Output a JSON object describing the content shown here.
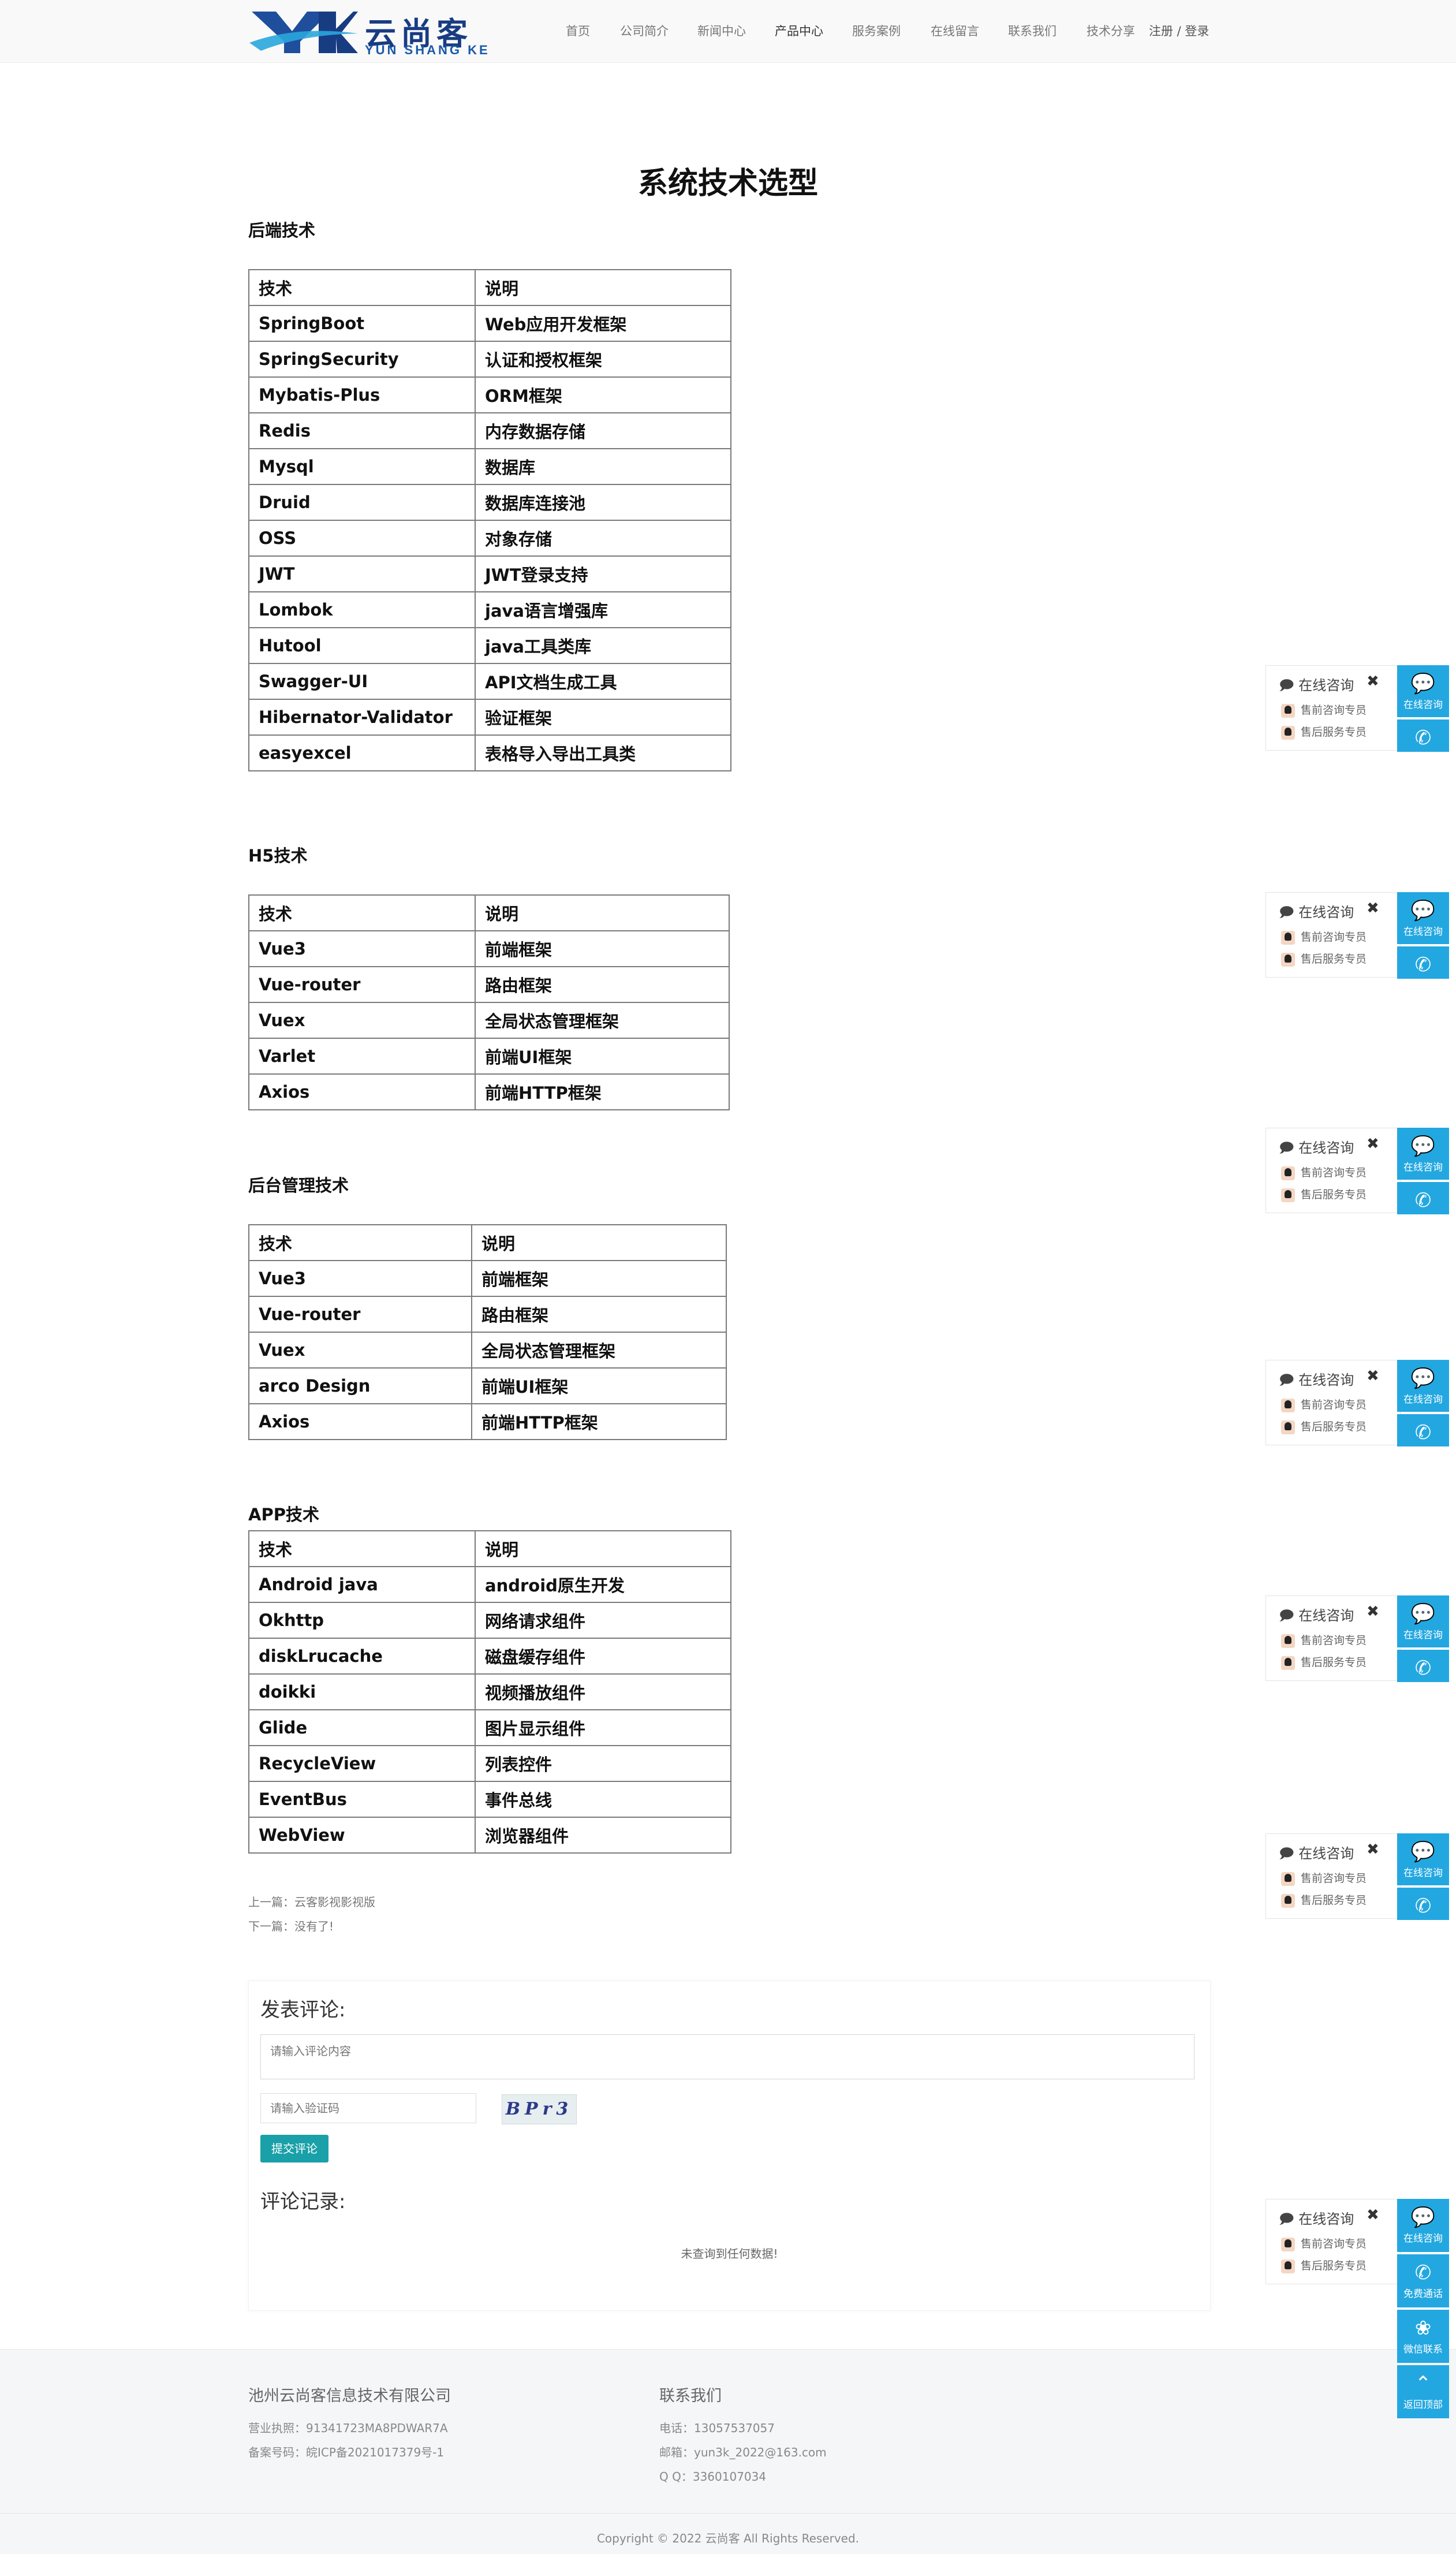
{
  "header": {
    "logo_cn": "云尚客",
    "logo_en": "YUN SHANG KE",
    "nav": [
      "首页",
      "公司简介",
      "新闻中心",
      "产品中心",
      "服务案例",
      "在线留言",
      "联系我们",
      "技术分享"
    ],
    "active_nav": "产品中心",
    "login": "注册 / 登录"
  },
  "article": {
    "title": "系统技术选型",
    "sections": [
      {
        "heading": "后端技术",
        "header": [
          "技术",
          "说明"
        ],
        "rows": [
          [
            "SpringBoot",
            "Web应用开发框架"
          ],
          [
            "SpringSecurity",
            "认证和授权框架"
          ],
          [
            "Mybatis-Plus",
            "ORM框架"
          ],
          [
            "Redis",
            "内存数据存储"
          ],
          [
            "Mysql",
            "数据库"
          ],
          [
            "Druid",
            "数据库连接池"
          ],
          [
            "OSS",
            "对象存储"
          ],
          [
            "JWT",
            "JWT登录支持"
          ],
          [
            "Lombok",
            "java语言增强库"
          ],
          [
            "Hutool",
            "java工具类库"
          ],
          [
            "Swagger-UI",
            "API文档生成工具"
          ],
          [
            "Hibernator-Validator",
            "验证框架"
          ],
          [
            "easyexcel",
            "表格导入导出工具类"
          ]
        ]
      },
      {
        "heading": "H5技术",
        "header": [
          "技术",
          "说明"
        ],
        "rows": [
          [
            "Vue3",
            "前端框架"
          ],
          [
            "Vue-router",
            "路由框架"
          ],
          [
            "Vuex",
            "全局状态管理框架"
          ],
          [
            "Varlet",
            "前端UI框架"
          ],
          [
            "Axios",
            "前端HTTP框架"
          ]
        ]
      },
      {
        "heading": "后台管理技术",
        "header": [
          "技术",
          "说明"
        ],
        "rows": [
          [
            "Vue3",
            "前端框架"
          ],
          [
            "Vue-router",
            "路由框架"
          ],
          [
            "Vuex",
            "全局状态管理框架"
          ],
          [
            "arco Design",
            "前端UI框架"
          ],
          [
            "Axios",
            "前端HTTP框架"
          ]
        ]
      },
      {
        "heading": "APP技术",
        "header": [
          "技术",
          "说明"
        ],
        "rows": [
          [
            "Android java",
            "android原生开发"
          ],
          [
            "Okhttp",
            "网络请求组件"
          ],
          [
            "diskLrucache",
            "磁盘缓存组件"
          ],
          [
            "doikki",
            "视频播放组件"
          ],
          [
            "Glide",
            "图片显示组件"
          ],
          [
            "RecycleView",
            "列表控件"
          ],
          [
            "EventBus",
            "事件总线"
          ],
          [
            "WebView",
            "浏览器组件"
          ]
        ]
      }
    ],
    "prev": "上一篇：云客影视影视版",
    "next": "下一篇：没有了!"
  },
  "comment": {
    "heading": "发表评论:",
    "textarea_placeholder": "请输入评论内容",
    "captcha_placeholder": "请输入验证码",
    "captcha_text": "BPr3",
    "submit": "提交评论",
    "records_heading": "评论记录:",
    "empty": "未查询到任何数据!"
  },
  "footer": {
    "company": "池州云尚客信息技术有限公司",
    "license": "营业执照：91341723MA8PDWAR7A",
    "icp": "备案号码：皖ICP备2021017379号-1",
    "contact_title": "联系我们",
    "phone": "电话：13057537057",
    "email": "邮箱：yun3k_2022@163.com",
    "qq": "Q Q：3360107034",
    "copyright": "Copyright © 2022 云尚客 All Rights Reserved."
  },
  "float_widget": {
    "title": "在线咨询",
    "close": "✖",
    "presale": "售前咨询专员",
    "aftersale": "售后服务专员",
    "btn_consult": "在线咨询",
    "btn_call": "免费通话",
    "btn_wechat": "微信联系",
    "btn_top": "返回顶部"
  }
}
